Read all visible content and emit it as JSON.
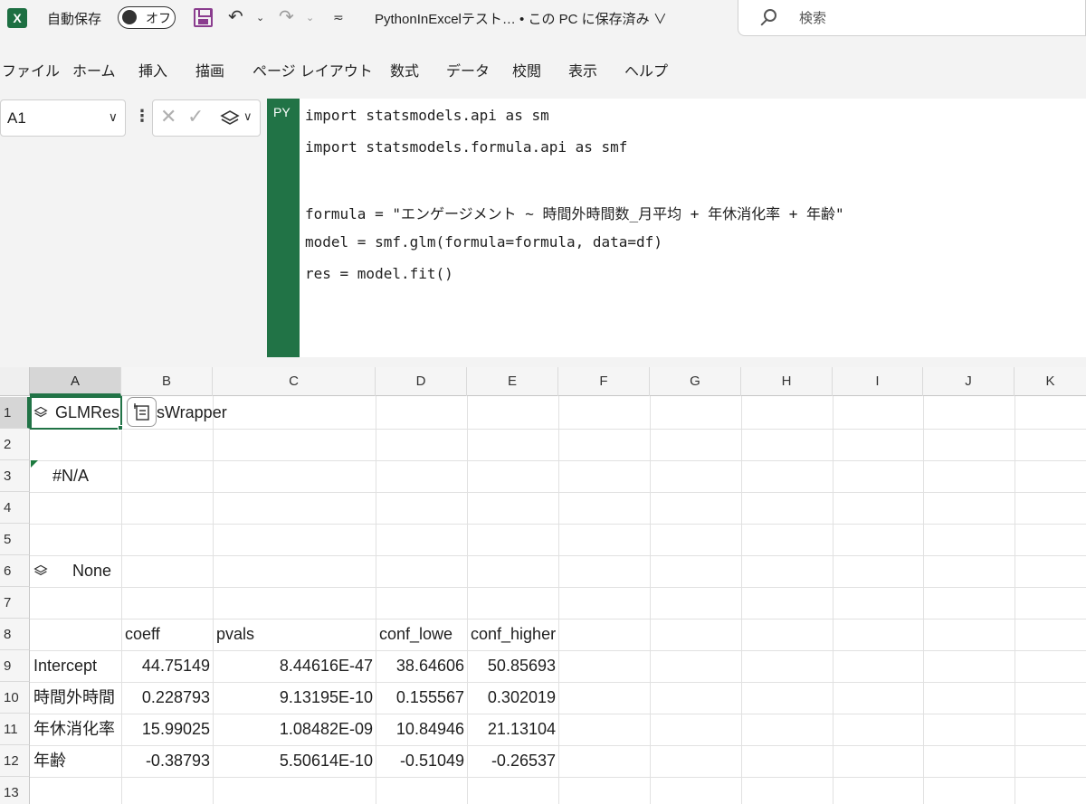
{
  "app": {
    "logo_letter": "X",
    "autosave_label": "自動保存",
    "autosave_state": "オフ",
    "doc_title": "PythonInExcelテスト… • この PC に保存済み ∨",
    "search_placeholder": "検索"
  },
  "ribbon": {
    "tabs": [
      "ファイル",
      "ホーム",
      "挿入",
      "描画",
      "ページ レイアウト",
      "数式",
      "データ",
      "校閲",
      "表示",
      "ヘルプ"
    ]
  },
  "formula_bar": {
    "name_box": "A1",
    "py_label": "PY",
    "code_lines": [
      "import statsmodels.api as sm",
      "import statsmodels.formula.api as smf",
      "",
      "formula = \"エンゲージメント ~ 時間外時間数_月平均 + 年休消化率 + 年齢\"",
      "model = smf.glm(formula=formula, data=df)",
      "res = model.fit()"
    ]
  },
  "grid": {
    "columns": [
      "A",
      "B",
      "C",
      "D",
      "E",
      "F",
      "G",
      "H",
      "I",
      "J",
      "K"
    ],
    "rows": [
      "1",
      "2",
      "3",
      "4",
      "5",
      "6",
      "7",
      "8",
      "9",
      "10",
      "11",
      "12",
      "13"
    ],
    "a1_left": "GLMRes",
    "a1_right": "sWrapper",
    "a3": "#N/A",
    "a6": "None",
    "table_headers": [
      "coeff",
      "pvals",
      "conf_lowe",
      "conf_higher"
    ],
    "table_rows": [
      {
        "label": "Intercept",
        "coeff": "44.75149",
        "pvals": "8.44616E-47",
        "conf_lower": "38.64606",
        "conf_higher": "50.85693"
      },
      {
        "label": "時間外時間",
        "coeff": "0.228793",
        "pvals": "9.13195E-10",
        "conf_lower": "0.155567",
        "conf_higher": "0.302019"
      },
      {
        "label": "年休消化率",
        "coeff": "15.99025",
        "pvals": "1.08482E-09",
        "conf_lower": "10.84946",
        "conf_higher": "21.13104"
      },
      {
        "label": "年齢",
        "coeff": "-0.38793",
        "pvals": "5.50614E-10",
        "conf_lower": "-0.51049",
        "conf_higher": "-0.26537"
      }
    ]
  },
  "colors": {
    "excel_green": "#217346",
    "save_purple": "#8a3c8e",
    "chrome_gray": "#f3f3f3"
  }
}
